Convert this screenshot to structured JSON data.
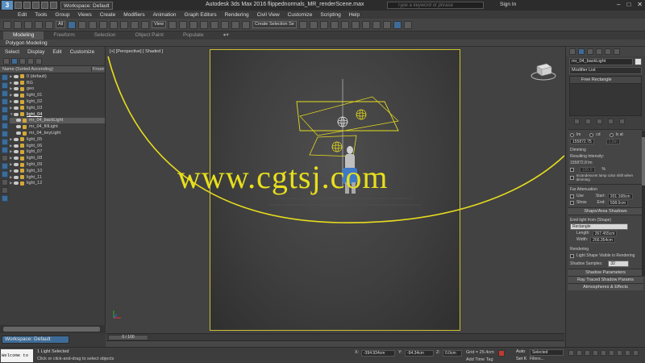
{
  "titlebar": {
    "workspace": "Workspace: Default",
    "title": "Autodesk 3ds Max 2016     flippednormals_MR_renderScene.max",
    "search_placeholder": "Type a keyword or phrase",
    "signin": "Sign In",
    "logo": "3"
  },
  "menu": [
    "Edit",
    "Tools",
    "Group",
    "Views",
    "Create",
    "Modifiers",
    "Animation",
    "Graph Editors",
    "Rendering",
    "Civil View",
    "Customize",
    "Scripting",
    "Help"
  ],
  "toolbar": {
    "filter_dd": "All",
    "refcoord_dd": "View",
    "selset_dd": "Create Selection Se"
  },
  "ribbon": {
    "tabs": [
      "Modeling",
      "Freeform",
      "Selection",
      "Object Paint",
      "Populate"
    ],
    "active": "Modeling",
    "sub": "Polygon Modeling"
  },
  "explorer": {
    "menu": [
      "Select",
      "Display",
      "Edit",
      "Customize"
    ],
    "col_name": "Name (Sorted Ascending)",
    "col_frozen": "Froze",
    "rows": [
      {
        "label": "0 (default)",
        "type": "layer"
      },
      {
        "label": "BG",
        "type": "layer"
      },
      {
        "label": "geo",
        "type": "layer"
      },
      {
        "label": "light_01",
        "type": "layer"
      },
      {
        "label": "light_02",
        "type": "layer"
      },
      {
        "label": "light_03",
        "type": "layer"
      },
      {
        "label": "light_04",
        "type": "layer-open"
      },
      {
        "label": "mr_04_backLight",
        "type": "child-sel"
      },
      {
        "label": "mr_04_fillLight",
        "type": "child"
      },
      {
        "label": "mr_04_keyLight",
        "type": "child"
      },
      {
        "label": "light_05",
        "type": "layer"
      },
      {
        "label": "light_06",
        "type": "layer"
      },
      {
        "label": "light_07",
        "type": "layer"
      },
      {
        "label": "light_08",
        "type": "layer"
      },
      {
        "label": "light_09",
        "type": "layer"
      },
      {
        "label": "light_10",
        "type": "layer"
      },
      {
        "label": "light_11",
        "type": "layer"
      },
      {
        "label": "light_12",
        "type": "layer"
      }
    ]
  },
  "viewport": {
    "label": "[+] [Perspective] [ Shaded ]",
    "watermark": "www.cgtsj.com",
    "safe_frame_color": "#cfc030"
  },
  "command_panel": {
    "object_name": "mr_04_backLight",
    "modifier_list": "Modifier List",
    "stack_item": "Free Rectangle",
    "units": {
      "lm": "lm",
      "cd": "cd",
      "lx": "lx at"
    },
    "intensity_value": "155872.75",
    "intensity_unit": "1.0m",
    "dimming_label": "Dimming",
    "resulting_intensity_label": "Resulting Intensity:",
    "resulting_intensity_value": "155872.8 lm",
    "dim_percent": "100.0",
    "dim_percent_unit": "%",
    "incandescent_label": "Incandescent lamp color shift when dimming",
    "far_atten_label": "Far Attenuation",
    "use_label": "Use",
    "show_label": "Show",
    "start_label": "Start:",
    "start_value": "201.168cm",
    "end_label": "End:",
    "end_value": "508.0cm",
    "shape_rollout": "Shape/Area Shadows",
    "emit_label": "Emit light from (Shape)",
    "shape_value": "Rectangle",
    "length_label": "Length:",
    "length_value": "267.455cm",
    "width_label": "Width:",
    "width_value": "266.354cm",
    "rendering_label": "Rendering",
    "light_shape_visible": "Light Shape Visible in Rendering",
    "shadow_samples_label": "Shadow Samples:",
    "shadow_samples_value": "32",
    "rollouts": [
      "Shadow Parameters",
      "Ray Traced Shadow Params",
      "Atmospheres & Effects"
    ]
  },
  "timeline": {
    "slider": "0 / 100"
  },
  "workspace_bar": {
    "label": "Workspace: Default"
  },
  "status": {
    "maxscript": "Welcome to",
    "line1": "1 Light Selected",
    "line2": "Click or click-and-drag to select objects",
    "x_label": "X:",
    "x_value": "-394.934cm",
    "y_label": "Y:",
    "y_value": "-94.34cm",
    "z_label": "Z:",
    "z_value": "0.0cm",
    "grid": "Grid = 25.4cm",
    "add_time_tag": "Add Time Tag",
    "auto": "Auto",
    "setk": "Set K",
    "selected": "Selected",
    "filters": "Filters..."
  }
}
